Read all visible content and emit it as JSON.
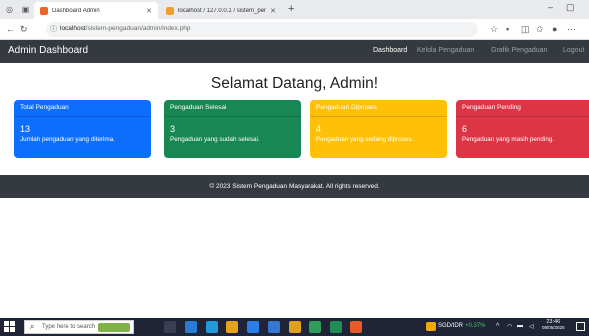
{
  "browser": {
    "tabs": [
      {
        "title": "Dashboard Admin",
        "active": true,
        "favicon_color": "#e8672a"
      },
      {
        "title": "localhost / 127.0.0.1 / sistem_pen",
        "active": false,
        "favicon_color": "#f0a030"
      }
    ],
    "new_tab_glyph": "+",
    "window_controls": [
      "–",
      "▢"
    ],
    "url_host": "localhost",
    "url_path": "/sistem-pengaduan/admin/index.php"
  },
  "app": {
    "brand": "Admin Dashboard",
    "nav": [
      {
        "label": "Dashboard",
        "active": true
      },
      {
        "label": "Kelola Pengaduan",
        "active": false
      },
      {
        "label": "Grafik Pengaduan",
        "active": false
      },
      {
        "label": "Logout",
        "active": false
      }
    ],
    "welcome": "Selamat Datang, Admin!",
    "cards": [
      {
        "title": "Total Pengaduan",
        "count": "13",
        "desc": "Jumlah pengaduan yang diterima.",
        "color": "#0d6efd"
      },
      {
        "title": "Pengaduan Selesai",
        "count": "3",
        "desc": "Pengaduan yang sudah selesai.",
        "color": "#198754"
      },
      {
        "title": "Pengaduan Diproses",
        "count": "4",
        "desc": "Pengaduan yang sedang diproses.",
        "color": "#ffc107"
      },
      {
        "title": "Pengaduan Pending",
        "count": "6",
        "desc": "Pengaduan yang masih pending.",
        "color": "#dc3545"
      }
    ],
    "footer": "© 2023 Sistem Pengaduan Masyarakat. All rights reserved."
  },
  "taskbar": {
    "search_placeholder": "Type here to search",
    "currency": "SGD/IDR",
    "currency_change": "+0.37%",
    "time": "23:46",
    "date": "08/05/2025"
  }
}
